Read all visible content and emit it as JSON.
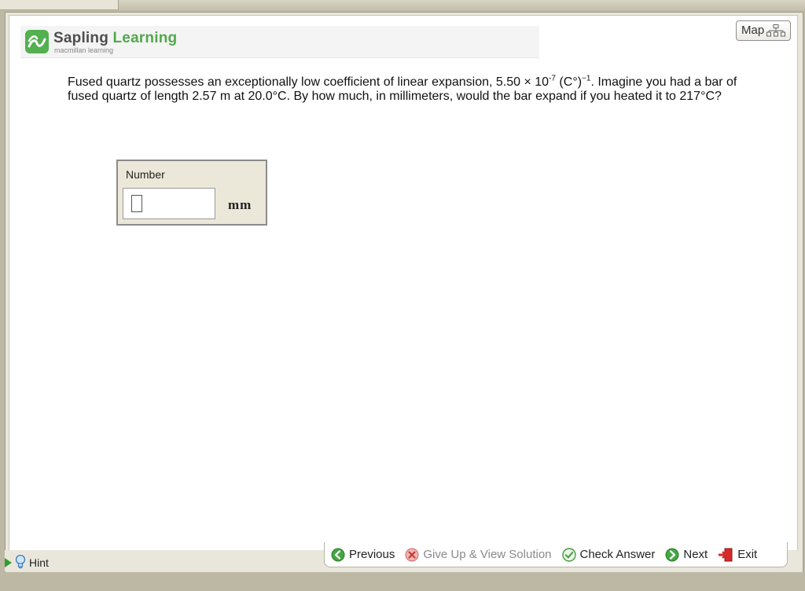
{
  "brand": {
    "name_part1": "Sapling",
    "name_part2": "Learning",
    "subtitle": "macmillan learning",
    "accent": "#52a84d"
  },
  "header": {
    "map_label": "Map"
  },
  "question": {
    "text_before_exp": "Fused quartz possesses an exceptionally low coefficient of linear expansion, 5.50 × 10",
    "exp1": "-7",
    "text_mid": " (C°)",
    "exp2": "−1",
    "text_after": ". Imagine you had a bar of fused quartz of length 2.57 m at 20.0°C. By how much, in millimeters, would the bar expand if you heated it to 217°C?"
  },
  "answer": {
    "label": "Number",
    "value": "",
    "unit": "mm"
  },
  "footer": {
    "hint_label": "Hint",
    "previous_label": "Previous",
    "give_up_label": "Give Up & View Solution",
    "check_label": "Check Answer",
    "next_label": "Next",
    "exit_label": "Exit"
  }
}
